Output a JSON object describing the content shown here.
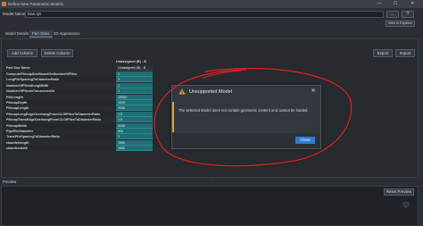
{
  "window": {
    "title": "Define New Parametric Models",
    "controls": [
      "—",
      "☐",
      "✕"
    ]
  },
  "model": {
    "label": "Model Name:",
    "value": "Dan.rpt",
    "browse_label": "...",
    "question_label": "?",
    "explorer_label": "View in Explorer"
  },
  "tabs": [
    {
      "label": "Model Details",
      "active": false
    },
    {
      "label": "Part Sizes",
      "active": true
    },
    {
      "label": "2D Appearance",
      "active": false
    }
  ],
  "toolbar": {
    "add_column": "Add Column",
    "delete_column": "Delete Column",
    "export": "Export",
    "import": "Import"
  },
  "table": {
    "column_header": "Unassigned (B) - B",
    "name_header": "Part Size Name",
    "name_header_value": "Unassigned (B) - B",
    "rows": [
      {
        "name": "ComputePilecapSizeBasedOnNumberOfPiles",
        "value": "1"
      },
      {
        "name": "LongPileSpacingToDiameterRatio",
        "value": "3"
      },
      {
        "name": "NumberOfPilesAlongWidth",
        "value": "1"
      },
      {
        "name": "NumberOfPilesInTransverseDir",
        "value": "1"
      },
      {
        "name": "PileLength",
        "value": "10000"
      },
      {
        "name": "PilecapDepth",
        "value": "1000"
      },
      {
        "name": "PilecapLength",
        "value": "2000"
      },
      {
        "name": "PilecapLongEdgeOverhangFromC/LOfPilesToDiameterRatio",
        "value": "1.5"
      },
      {
        "name": "PilecapTransEdgeOverhangFromC/LOfPilesToDiameterRatio",
        "value": "1.5"
      },
      {
        "name": "PilecapWidth",
        "value": "6000"
      },
      {
        "name": "PipePileDiameter",
        "value": "500"
      },
      {
        "name": "TransPileSpacingToDiameterRatio",
        "value": "3"
      },
      {
        "name": "chamferlength",
        "value": "1500"
      },
      {
        "name": "chamferwidth",
        "value": "1500"
      }
    ]
  },
  "dialog": {
    "title": "Unsupported Model",
    "message": "The selected Model does not contain geometric content and cannot be loaded.",
    "close_label": "Close",
    "close_icon": "✕",
    "icon": "warning-icon"
  },
  "preview": {
    "label": "Preview",
    "reset_label": "Reset Preview",
    "splitter": "....."
  },
  "colors": {
    "accent": "#2f7bd0",
    "warning": "#e5a128",
    "cell_fill": "#1f6d73",
    "annotation": "#e0221e"
  }
}
